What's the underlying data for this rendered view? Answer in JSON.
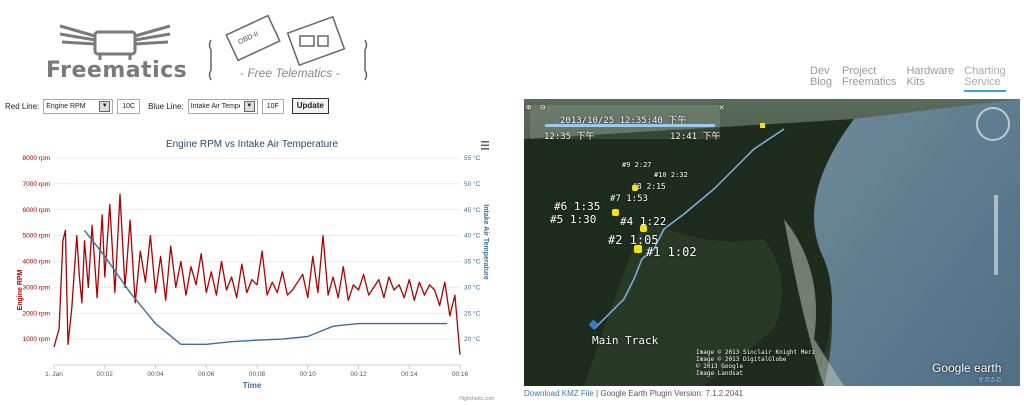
{
  "brand": {
    "name": "Freematics",
    "tagline": "- Free Telematics -",
    "device_label": "OBD-II"
  },
  "nav": [
    {
      "line1": "Dev",
      "line2": "Blog"
    },
    {
      "line1": "Project",
      "line2": "Freematics"
    },
    {
      "line1": "Hardware",
      "line2": "Kits"
    },
    {
      "line1": "Charting",
      "line2": "Service"
    }
  ],
  "controls": {
    "red_label": "Red Line:",
    "red_value": "Engine RPM",
    "red_ticks": "10C",
    "blue_label": "Blue Line:",
    "blue_value": "Intake Air Temperat",
    "blue_ticks": "10F",
    "update_label": "Update"
  },
  "chart_data": {
    "type": "line",
    "title": "Engine RPM vs Intake Air Temperature",
    "xlabel": "Time",
    "y_left_label": "Engine RPM",
    "y_right_label": "Intake Air Temperature",
    "x_ticks": [
      "1. Jan",
      "00:02",
      "00:04",
      "00:06",
      "00:08",
      "00:10",
      "00:12",
      "00:14",
      "00:16"
    ],
    "y_left_ticks": [
      "1000 rpm",
      "2000 rpm",
      "3000 rpm",
      "4000 rpm",
      "5000 rpm",
      "6000 rpm",
      "7000 rpm",
      "8000 rpm"
    ],
    "y_right_ticks": [
      "20 °C",
      "25 °C",
      "30 °C",
      "35 °C",
      "40 °C",
      "45 °C",
      "50 °C",
      "55 °C"
    ],
    "y_left_range": [
      0,
      8000
    ],
    "y_right_range": [
      15,
      55
    ],
    "x_range_min": [
      0,
      16
    ],
    "credit": "Highcharts.com",
    "series": [
      {
        "name": "Engine RPM",
        "color": "#b10000",
        "x": [
          0,
          0.2,
          0.35,
          0.45,
          0.55,
          0.7,
          0.9,
          1.0,
          1.1,
          1.2,
          1.35,
          1.5,
          1.7,
          1.9,
          2.0,
          2.2,
          2.4,
          2.6,
          2.8,
          3.0,
          3.2,
          3.4,
          3.6,
          3.8,
          4.0,
          4.2,
          4.4,
          4.6,
          4.8,
          5.0,
          5.2,
          5.4,
          5.6,
          5.8,
          6.0,
          6.2,
          6.4,
          6.6,
          6.8,
          7.0,
          7.2,
          7.4,
          7.6,
          7.8,
          8.0,
          8.2,
          8.4,
          8.6,
          8.8,
          9.0,
          9.2,
          9.4,
          9.6,
          9.8,
          10.0,
          10.2,
          10.4,
          10.6,
          10.8,
          11.0,
          11.2,
          11.4,
          11.6,
          11.8,
          12.0,
          12.2,
          12.4,
          12.6,
          12.8,
          13.0,
          13.2,
          13.4,
          13.6,
          13.8,
          14.0,
          14.2,
          14.4,
          14.6,
          14.8,
          15.0,
          15.2,
          15.4,
          15.6,
          15.8,
          16.0
        ],
        "values": [
          700,
          1400,
          4800,
          5200,
          800,
          2200,
          5000,
          3400,
          2400,
          4800,
          3000,
          5400,
          2600,
          5800,
          3400,
          6200,
          2800,
          6600,
          3000,
          5600,
          2400,
          4400,
          3200,
          5000,
          2800,
          4200,
          2500,
          4600,
          3000,
          4000,
          2700,
          3800,
          3100,
          4300,
          2800,
          3600,
          2700,
          4000,
          2900,
          3400,
          2600,
          3900,
          2800,
          3300,
          3100,
          4400,
          2700,
          3200,
          2800,
          3600,
          2700,
          2900,
          3200,
          3500,
          2600,
          4200,
          2800,
          5000,
          2700,
          3400,
          2600,
          3800,
          2500,
          3100,
          2900,
          3500,
          2700,
          3000,
          3300,
          2600,
          3400,
          2900,
          3100,
          2600,
          3300,
          2500,
          3200,
          2700,
          3100,
          2900,
          2300,
          3200,
          1900,
          2700,
          400
        ]
      },
      {
        "name": "Intake Air Temperature",
        "color": "#3d6e9c",
        "x": [
          1.2,
          2.0,
          3.0,
          4.0,
          5.0,
          6.0,
          7.0,
          8.0,
          9.0,
          10.0,
          10.5,
          11.0,
          12.0,
          13.0,
          14.0,
          15.0,
          15.5
        ],
        "values": [
          41,
          36,
          29,
          23,
          19,
          19,
          19.5,
          19.8,
          20,
          20.5,
          21.5,
          22.5,
          23,
          23,
          23,
          23,
          23
        ]
      }
    ]
  },
  "map": {
    "date_readout": "2013/10/25  12:35:40  下午",
    "time_start": "12:35 下午",
    "time_end": "12:41 下午",
    "waypoints": [
      "#1 1:02",
      "#2 1:05",
      "#4 1:22",
      "#5 1:30",
      "#6 1:35",
      "#7 1:53",
      "#8 2:15",
      "#9 2:27",
      "#10 2:32"
    ],
    "track_label": "Main Track",
    "credits": [
      "Image © 2013 Sinclair Knight Merz",
      "Image © 2013 DigitalGlobe",
      "© 2013 Google",
      "Image Landsat"
    ],
    "brand": "Google earth",
    "usage_terms": "使用条款"
  },
  "footer": {
    "download": "Download KMZ File",
    "separator": "|",
    "plugin_version": "Google Earth Plugin Version: 7.1.2.2041"
  }
}
